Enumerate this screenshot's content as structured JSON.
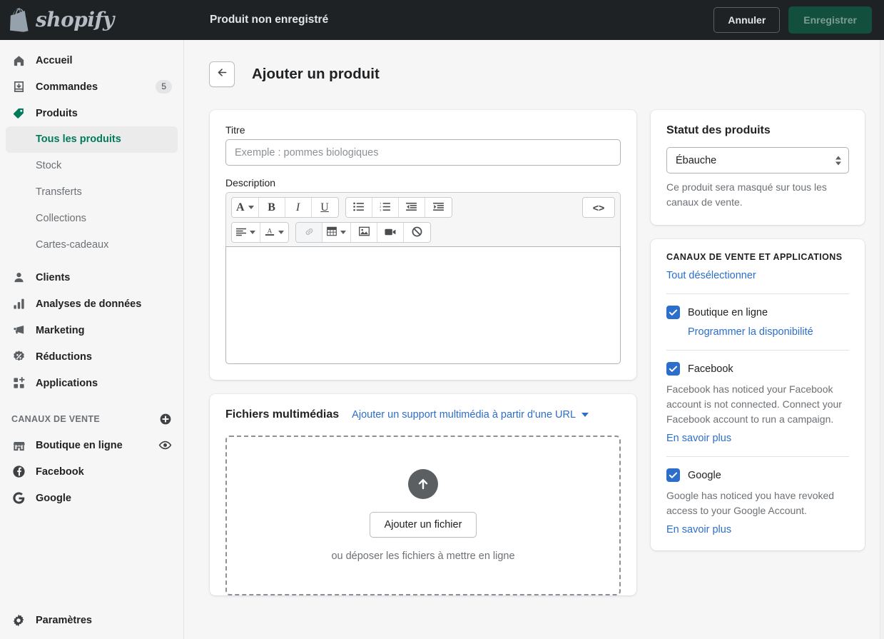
{
  "topbar": {
    "brand": "shopify",
    "brand_icon": "shopify-bag-icon",
    "title": "Produit non enregistré",
    "cancel_label": "Annuler",
    "save_label": "Enregistrer"
  },
  "sidebar": {
    "items": [
      {
        "label": "Accueil",
        "icon": "home-icon",
        "badge": ""
      },
      {
        "label": "Commandes",
        "icon": "orders-inbox-icon",
        "badge": "5"
      },
      {
        "label": "Produits",
        "icon": "product-tag-icon",
        "badge": ""
      }
    ],
    "subitems": [
      {
        "label": "Tous les produits",
        "active": true
      },
      {
        "label": "Stock",
        "active": false
      },
      {
        "label": "Transferts",
        "active": false
      },
      {
        "label": "Collections",
        "active": false
      },
      {
        "label": "Cartes-cadeaux",
        "active": false
      }
    ],
    "items2": [
      {
        "label": "Clients",
        "icon": "customer-icon"
      },
      {
        "label": "Analyses de données",
        "icon": "analytics-bars-icon"
      },
      {
        "label": "Marketing",
        "icon": "megaphone-icon"
      },
      {
        "label": "Réductions",
        "icon": "discount-badge-icon"
      },
      {
        "label": "Applications",
        "icon": "apps-grid-plus-icon"
      }
    ],
    "channels_header": "CANAUX DE VENTE",
    "channels_add_icon": "plus-circle-icon",
    "channels": [
      {
        "label": "Boutique en ligne",
        "icon": "storefront-icon",
        "action_icon": "eye-icon"
      },
      {
        "label": "Facebook",
        "icon": "facebook-icon",
        "action_icon": ""
      },
      {
        "label": "Google",
        "icon": "google-g-icon",
        "action_icon": ""
      }
    ],
    "settings": {
      "label": "Paramètres",
      "icon": "gear-icon"
    }
  },
  "page": {
    "back_icon": "arrow-left-icon",
    "title": "Ajouter un produit"
  },
  "product_form": {
    "title_label": "Titre",
    "title_value": "",
    "title_placeholder": "Exemple : pommes biologiques",
    "description_label": "Description",
    "description_value": "",
    "toolbar_row1": [
      {
        "icon": "font-format-icon",
        "glyph": "A",
        "caret": true,
        "disabled": false,
        "name": "format-dropdown"
      },
      {
        "icon": "bold-icon",
        "glyph": "B",
        "caret": false,
        "disabled": false,
        "name": "bold-button"
      },
      {
        "icon": "italic-icon",
        "glyph": "I",
        "caret": false,
        "disabled": false,
        "name": "italic-button"
      },
      {
        "icon": "underline-icon",
        "glyph": "U",
        "caret": false,
        "disabled": false,
        "name": "underline-button"
      },
      {
        "icon": "bulleted-list-icon",
        "glyph": "",
        "caret": false,
        "disabled": false,
        "name": "bulleted-list-button"
      },
      {
        "icon": "numbered-list-icon",
        "glyph": "",
        "caret": false,
        "disabled": false,
        "name": "numbered-list-button"
      },
      {
        "icon": "outdent-icon",
        "glyph": "",
        "caret": false,
        "disabled": false,
        "name": "outdent-button"
      },
      {
        "icon": "indent-icon",
        "glyph": "",
        "caret": false,
        "disabled": false,
        "name": "indent-button"
      },
      {
        "icon": "code-view-icon",
        "glyph": "<>",
        "caret": false,
        "disabled": false,
        "name": "html-code-button"
      }
    ],
    "toolbar_row2": [
      {
        "icon": "align-left-icon",
        "caret": true,
        "disabled": false,
        "name": "alignment-dropdown"
      },
      {
        "icon": "text-color-icon",
        "caret": true,
        "disabled": false,
        "name": "text-color-dropdown"
      },
      {
        "icon": "link-icon",
        "caret": false,
        "disabled": true,
        "name": "insert-link-button"
      },
      {
        "icon": "table-icon",
        "caret": true,
        "disabled": false,
        "name": "insert-table-dropdown"
      },
      {
        "icon": "image-icon",
        "caret": false,
        "disabled": false,
        "name": "insert-image-button"
      },
      {
        "icon": "video-icon",
        "caret": false,
        "disabled": false,
        "name": "insert-video-button"
      },
      {
        "icon": "clear-formatting-icon",
        "caret": false,
        "disabled": false,
        "name": "clear-formatting-button"
      }
    ]
  },
  "media": {
    "title": "Fichiers multimédias",
    "url_link": "Ajouter un support multimédia à partir d'une URL",
    "url_link_icon": "chevron-down-icon",
    "upload_icon": "upload-arrow-icon",
    "add_file_button": "Ajouter un fichier",
    "drop_hint": "ou déposer les fichiers à mettre en ligne"
  },
  "status_panel": {
    "title": "Statut des produits",
    "selected": "Ébauche",
    "select_icon": "select-updown-arrows-icon",
    "help": "Ce produit sera masqué sur tous les canaux de vente."
  },
  "channels_panel": {
    "header": "CANAUX DE VENTE ET APPLICATIONS",
    "deselect_all": "Tout désélectionner",
    "items": [
      {
        "label": "Boutique en ligne",
        "checked": true,
        "sub_link": "Programmer la disponibilité",
        "desc": "",
        "learn_more": ""
      },
      {
        "label": "Facebook",
        "checked": true,
        "sub_link": "",
        "desc": "Facebook has noticed your Facebook account is not connected. Connect your Facebook account to run a campaign.",
        "learn_more": "En savoir plus"
      },
      {
        "label": "Google",
        "checked": true,
        "sub_link": "",
        "desc": "Google has noticed you have revoked access to your Google Account.",
        "learn_more": "En savoir plus"
      }
    ]
  },
  "colors": {
    "topbar_bg": "#1f2225",
    "accent_green": "#007b5c",
    "link_blue": "#2c6ecb",
    "checkbox_blue": "#2c6ecb",
    "page_bg": "#f6f6f7"
  }
}
